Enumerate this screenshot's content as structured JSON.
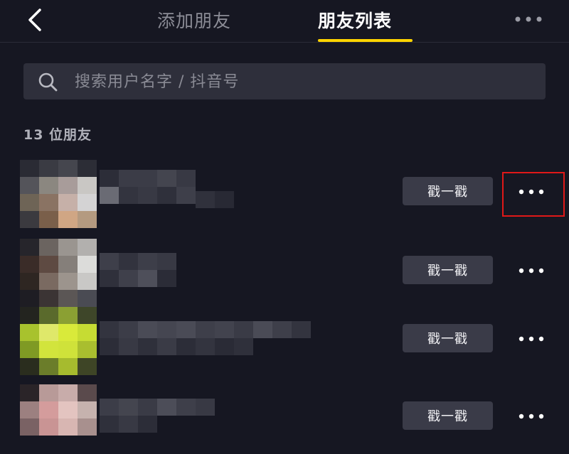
{
  "header": {
    "tabs": [
      {
        "label": "添加朋友",
        "active": false
      },
      {
        "label": "朋友列表",
        "active": true
      }
    ],
    "back_icon": "chevron-left-icon",
    "more_icon": "more-horizontal-icon",
    "accent_color": "#ffd400"
  },
  "search": {
    "placeholder": "搜索用户名字 / 抖音号",
    "value": "",
    "icon": "search-icon"
  },
  "friends": {
    "count_label": "13 位朋友",
    "items": [
      {
        "action_label": "戳一戳",
        "more_icon": "more-horizontal-icon",
        "highlighted": true
      },
      {
        "action_label": "戳一戳",
        "more_icon": "more-horizontal-icon",
        "highlighted": false
      },
      {
        "action_label": "戳一戳",
        "more_icon": "more-horizontal-icon",
        "highlighted": false
      },
      {
        "action_label": "戳一戳",
        "more_icon": "more-horizontal-icon",
        "highlighted": false
      }
    ]
  },
  "colors": {
    "background": "#161722",
    "button_bg": "#3a3b48",
    "highlight": "#e01818"
  }
}
